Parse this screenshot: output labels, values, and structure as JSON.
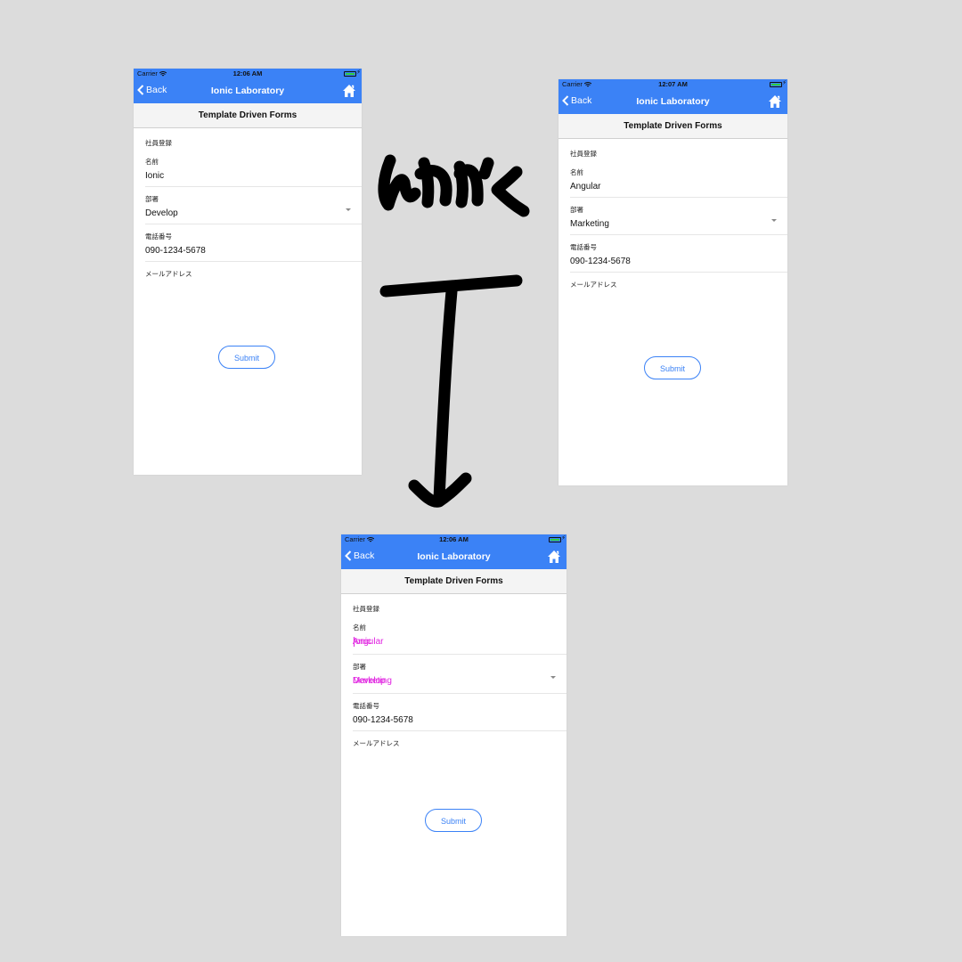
{
  "colors": {
    "accent": "#3b82f6",
    "overlap_text": "#e022e0",
    "background": "#dcdcdc"
  },
  "screens": {
    "left": {
      "status": {
        "carrier": "Carrier",
        "time": "12:06 AM"
      },
      "nav": {
        "back": "Back",
        "title": "Ionic Laboratory"
      },
      "subheader": "Template Driven Forms",
      "section": "社員登録",
      "fields": {
        "name_label": "名前",
        "name_value": "Ionic",
        "dept_label": "部署",
        "dept_value": "Develop",
        "phone_label": "電話番号",
        "phone_value": "090-1234-5678",
        "email_label": "メールアドレス"
      },
      "submit": "Submit"
    },
    "right": {
      "status": {
        "carrier": "Carrier",
        "time": "12:07 AM"
      },
      "nav": {
        "back": "Back",
        "title": "Ionic Laboratory"
      },
      "subheader": "Template Driven Forms",
      "section": "社員登録",
      "fields": {
        "name_label": "名前",
        "name_value": "Angular",
        "dept_label": "部署",
        "dept_value": "Marketing",
        "phone_label": "電話番号",
        "phone_value": "090-1234-5678",
        "email_label": "メールアドレス"
      },
      "submit": "Submit"
    },
    "bottom": {
      "status": {
        "carrier": "Carrier",
        "time": "12:06 AM"
      },
      "nav": {
        "back": "Back",
        "title": "Ionic Laboratory"
      },
      "subheader": "Template Driven Forms",
      "section": "社員登録",
      "fields": {
        "name_label": "名前",
        "name_value_a": "Ionic",
        "name_value_b": "Angular",
        "dept_label": "部署",
        "dept_value_a": "Develop",
        "dept_value_b": "Marketing",
        "phone_label": "電話番号",
        "phone_value": "090-1234-5678",
        "email_label": "メールアドレス"
      },
      "submit": "Submit"
    }
  },
  "annotation": {
    "handwritten_text": "いれかく",
    "arrow": "down-arrow"
  }
}
